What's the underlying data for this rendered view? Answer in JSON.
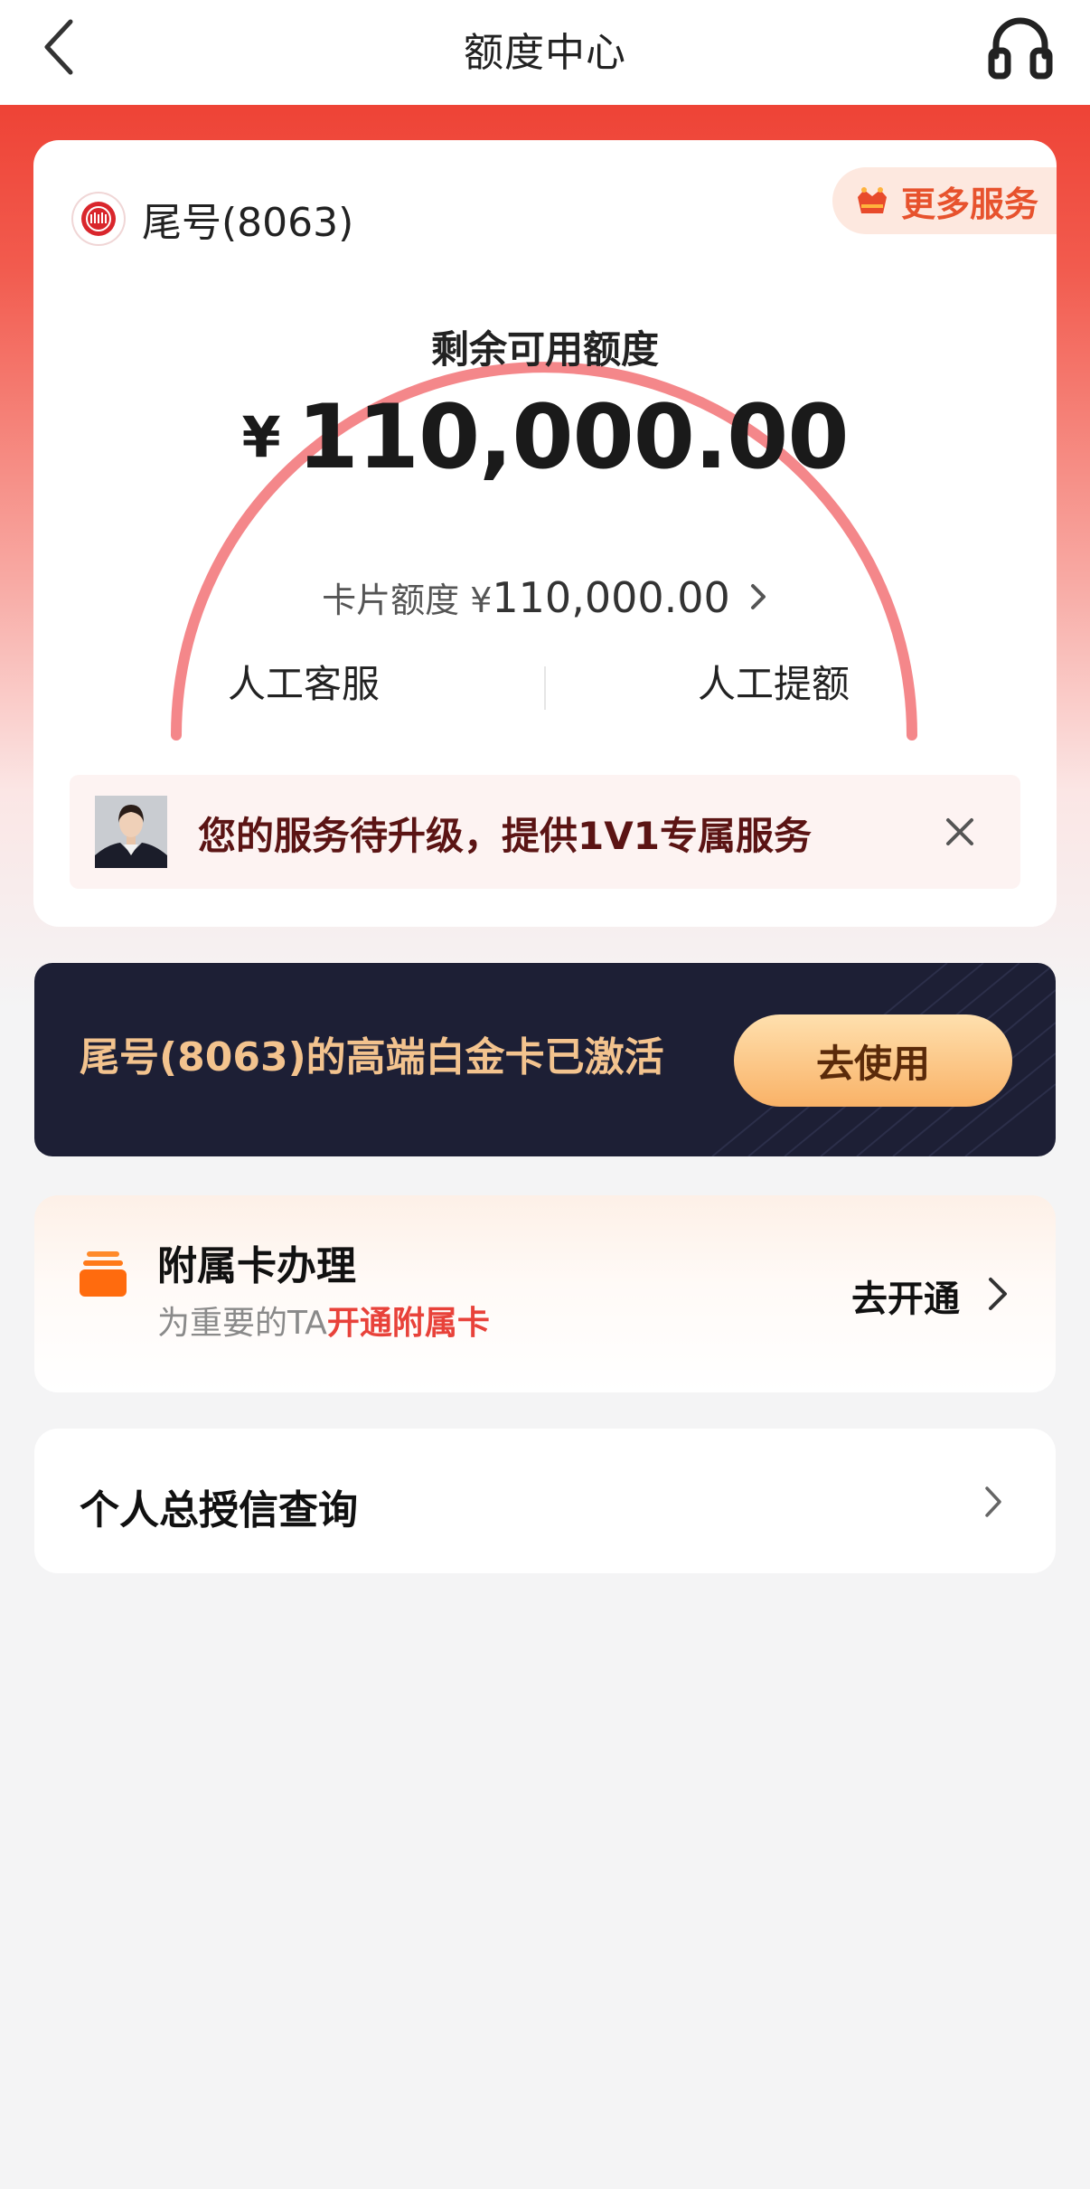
{
  "header": {
    "title": "额度中心",
    "back_icon": "chevron-left-icon",
    "service_icon": "headset-icon"
  },
  "card": {
    "bank_logo": "citic-bank-logo",
    "card_tail_label": "尾号(8063)",
    "more_service_label": "更多服务",
    "remaining_label": "剩余可用额度",
    "currency_symbol": "¥",
    "remaining_amount": "110,000.00",
    "card_limit_label": "卡片额度 ¥",
    "card_limit_value": "110,000.00",
    "usage_fraction": 0,
    "actions": {
      "left": "人工客服",
      "right": "人工提额"
    }
  },
  "upgrade_banner": {
    "text": "您的服务待升级，提供1V1专属服务"
  },
  "platinum_banner": {
    "text": "尾号(8063)的高端白金卡已激活",
    "button_label": "去使用"
  },
  "supplementary_card": {
    "title": "附属卡办理",
    "desc_prefix": "为重要的TA",
    "desc_highlight": "开通附属卡",
    "action_label": "去开通"
  },
  "credit_query": {
    "label": "个人总授信查询"
  },
  "colors": {
    "brand_red": "#ee4336",
    "gauge_arc": "#f4878a",
    "platinum_bg": "#1d1f35",
    "platinum_text": "#f3c38e",
    "highlight_red": "#e8423a"
  }
}
